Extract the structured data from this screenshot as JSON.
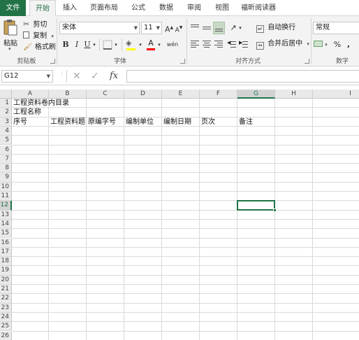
{
  "tabs": [
    "文件",
    "开始",
    "插入",
    "页面布局",
    "公式",
    "数据",
    "审阅",
    "视图",
    "福昕阅读器"
  ],
  "active_tab": "开始",
  "clipboard": {
    "paste_label": "粘贴",
    "cut_label": "剪切",
    "copy_label": "复制",
    "format_painter_label": "格式刷",
    "group_label": "剪贴板"
  },
  "font": {
    "font_name": "宋体",
    "font_size": "11",
    "grow_label": "A",
    "shrink_label": "A",
    "bold_label": "B",
    "italic_label": "I",
    "underline_label": "U",
    "font_color_label": "A",
    "group_label": "字体"
  },
  "alignment": {
    "wrap_text_label": "自动换行",
    "merge_center_label": "合并后居中",
    "group_label": "对齐方式"
  },
  "number": {
    "format_value": "常规",
    "percent_label": "%",
    "comma_label": ",",
    "group_label": "数字"
  },
  "formula_bar": {
    "name_box": "G12",
    "cancel_symbol": "✕",
    "enter_symbol": "✓",
    "fx_label": "fx",
    "formula_value": ""
  },
  "sheet": {
    "columns": [
      "A",
      "B",
      "C",
      "D",
      "E",
      "F",
      "G",
      "H",
      "I"
    ],
    "rows": [
      "1",
      "2",
      "3",
      "4",
      "5",
      "6",
      "7",
      "8",
      "9",
      "10",
      "11",
      "12",
      "13",
      "14",
      "15",
      "16",
      "17",
      "18",
      "19",
      "20",
      "21",
      "22",
      "23",
      "24",
      "25",
      "26"
    ],
    "selected_column": "G",
    "selected_row": "12",
    "selected_cell": "G12",
    "title": "工程资料卷内目录",
    "project_name_label": "工程名称",
    "headers": [
      "序号",
      "工程资料题名",
      "原编字号",
      "编制单位",
      "编制日期",
      "页次",
      "备注"
    ]
  }
}
